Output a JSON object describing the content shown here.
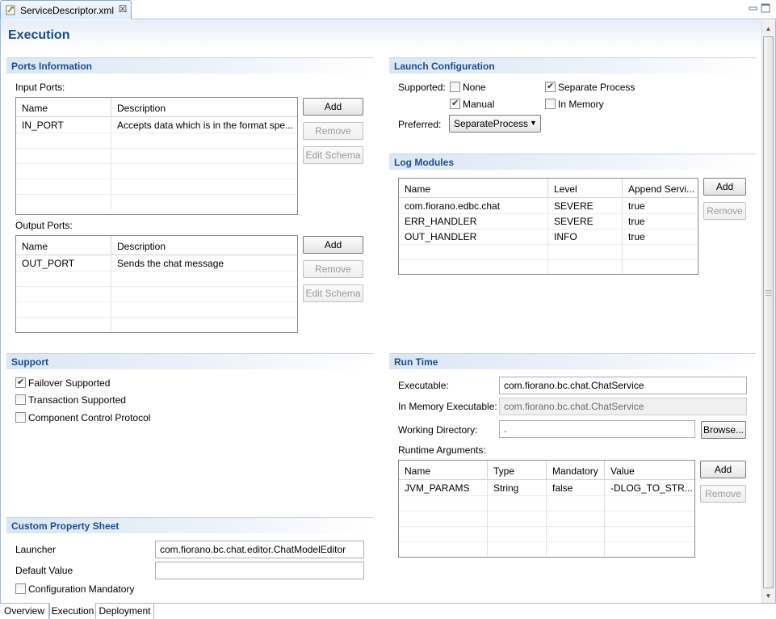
{
  "editor": {
    "tab_title": "ServiceDescriptor.xml",
    "page_title": "Execution"
  },
  "ports": {
    "section_title": "Ports Information",
    "input_label": "Input Ports:",
    "output_label": "Output Ports:",
    "columns": [
      "Name",
      "Description"
    ],
    "input_rows": [
      {
        "name": "IN_PORT",
        "description": "Accepts data which is in the format spe..."
      }
    ],
    "output_rows": [
      {
        "name": "OUT_PORT",
        "description": "Sends the chat message"
      }
    ],
    "add_label": "Add",
    "remove_label": "Remove",
    "edit_schema_label": "Edit Schema"
  },
  "launch": {
    "section_title": "Launch Configuration",
    "supported_label": "Supported:",
    "none_label": "None",
    "separate_label": "Separate Process",
    "manual_label": "Manual",
    "inmemory_label": "In Memory",
    "preferred_label": "Preferred:",
    "preferred_value": "SeparateProcess",
    "none_checked": false,
    "separate_checked": true,
    "manual_checked": true,
    "inmemory_checked": false
  },
  "log": {
    "section_title": "Log Modules",
    "columns": [
      "Name",
      "Level",
      "Append Servi..."
    ],
    "rows": [
      {
        "name": "com.fiorano.edbc.chat",
        "level": "SEVERE",
        "append": "true"
      },
      {
        "name": "ERR_HANDLER",
        "level": "SEVERE",
        "append": "true"
      },
      {
        "name": "OUT_HANDLER",
        "level": "INFO",
        "append": "true"
      }
    ],
    "add_label": "Add",
    "remove_label": "Remove"
  },
  "support": {
    "section_title": "Support",
    "failover_label": "Failover Supported",
    "transaction_label": "Transaction Supported",
    "control_label": "Component Control Protocol",
    "failover_checked": true,
    "transaction_checked": false,
    "control_checked": false
  },
  "runtime": {
    "section_title": "Run Time",
    "executable_label": "Executable:",
    "executable_value": "com.fiorano.bc.chat.ChatService",
    "inmem_exec_label": "In Memory Executable:",
    "inmem_exec_value": "com.fiorano.bc.chat.ChatService",
    "workdir_label": "Working Directory:",
    "workdir_value": ".",
    "browse_label": "Browse...",
    "args_label": "Runtime Arguments:",
    "columns": [
      "Name",
      "Type",
      "Mandatory",
      "Value"
    ],
    "rows": [
      {
        "name": "JVM_PARAMS",
        "type": "String",
        "mandatory": "false",
        "value": "-DLOG_TO_STR..."
      }
    ],
    "add_label": "Add",
    "remove_label": "Remove"
  },
  "custom": {
    "section_title": "Custom Property Sheet",
    "launcher_label": "Launcher",
    "launcher_value": "com.fiorano.bc.chat.editor.ChatModelEditor",
    "default_label": "Default Value",
    "default_value": "",
    "config_mandatory_label": "Configuration Mandatory",
    "config_mandatory_checked": false
  },
  "bottom_tabs": [
    "Overview",
    "Execution",
    "Deployment"
  ],
  "colors": {
    "section_title": "#1c4e8a",
    "header_gradient_start": "#dbe6f4",
    "border": "#a8b8cf"
  }
}
